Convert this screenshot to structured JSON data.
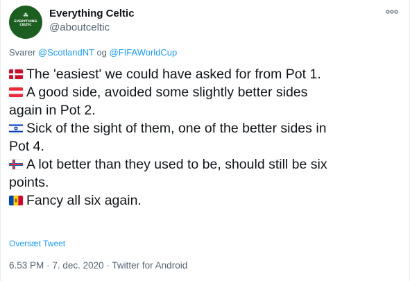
{
  "author": {
    "display_name": "Everything Celtic",
    "handle": "@aboutceltic",
    "avatar_logo_text": "EVERYTHING CELTIC"
  },
  "more_icon": "more-horizontal-icon",
  "reply": {
    "prefix": "Svarer",
    "mention_1": "@ScotlandNT",
    "joiner": "og",
    "mention_2": "@FIFAWorldCup"
  },
  "tweet": {
    "lines": [
      {
        "flag": "denmark-flag-icon",
        "text": "The 'easiest' we could have asked for from Pot 1."
      },
      {
        "flag": "austria-flag-icon",
        "text": "A good side, avoided some slightly better sides"
      },
      {
        "flag": "",
        "text": "again in Pot 2."
      },
      {
        "flag": "israel-flag-icon",
        "text": "Sick of the sight of them, one of the better sides in"
      },
      {
        "flag": "",
        "text": "Pot 4."
      },
      {
        "flag": "faroe-islands-flag-icon",
        "text": "A lot better than they used to be, should still be six"
      },
      {
        "flag": "",
        "text": "points."
      },
      {
        "flag": "moldova-flag-icon",
        "text": "Fancy all six again."
      }
    ]
  },
  "translate_label": "Oversæt Tweet",
  "meta": {
    "time": "6.53 PM",
    "date": "7. dec. 2020",
    "source": "Twitter for Android",
    "separator": "·"
  },
  "colors": {
    "text": "#0f1419",
    "secondary": "#536471",
    "link": "#1d9bf0"
  }
}
